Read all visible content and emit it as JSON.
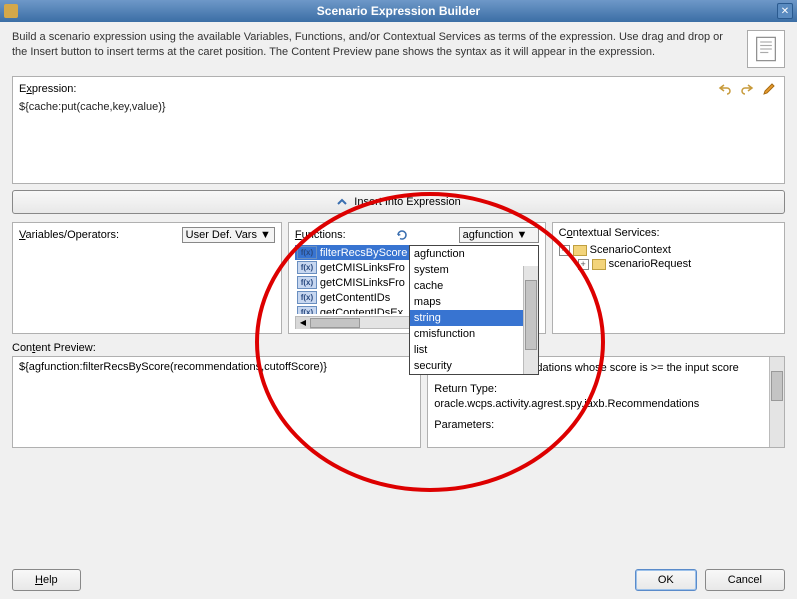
{
  "titlebar": {
    "title": "Scenario Expression Builder"
  },
  "intro": "Build a scenario expression using the available Variables, Functions, and/or Contextual Services as terms of the expression. Use drag and drop or the Insert button to insert terms at the caret position. The Content Preview pane shows the syntax as it will appear in the expression.",
  "expression": {
    "label_pre": "E",
    "label_underline": "x",
    "label_post": "pression:",
    "value": "${cache:put(cache,key,value)}"
  },
  "insert_button": "Insert Into Expression",
  "variables": {
    "label_pre": "",
    "label_underline": "V",
    "label_post": "ariables/Operators:",
    "select": "User Def. Vars"
  },
  "functions": {
    "label_pre": "",
    "label_underline": "F",
    "label_post": "unctions:",
    "selected_dropdown": "agfunction",
    "items": [
      "filterRecsByScore",
      "getCMISLinksFro",
      "getCMISLinksFro",
      "getContentIDs",
      "getContentIDsEx"
    ],
    "dropdown_options": [
      "agfunction",
      "system",
      "cache",
      "maps",
      "string",
      "cmisfunction",
      "list",
      "security"
    ],
    "dropdown_highlight": "string"
  },
  "contextual": {
    "label_pre": "C",
    "label_underline": "o",
    "label_post": "ntextual Services:",
    "tree": {
      "root": "ScenarioContext",
      "child": "scenarioRequest"
    }
  },
  "preview": {
    "label_pre": "Con",
    "label_underline": "t",
    "label_post": "ent Preview:",
    "left": "${agfunction:filterRecsByScore(recommendations,cutoffScore)}",
    "right_desc": "Filter out Recommendations whose score is >= the input score",
    "right_return_label": "Return Type:",
    "right_return_value": "oracle.wcps.activity.agrest.spy.jaxb.Recommendations",
    "right_params": "Parameters:"
  },
  "footer": {
    "help": "Help",
    "ok": "OK",
    "cancel": "Cancel"
  }
}
